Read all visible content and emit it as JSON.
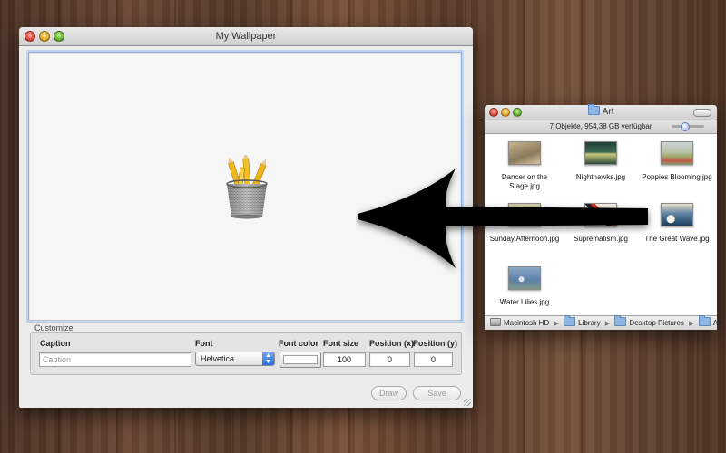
{
  "main_window": {
    "title": "My Wallpaper",
    "customize_label": "Customize",
    "caption": {
      "label": "Caption",
      "placeholder": "Caption",
      "value": ""
    },
    "font": {
      "label": "Font",
      "value": "Helvetica"
    },
    "font_color": {
      "label": "Font color",
      "value": "#ffffff"
    },
    "font_size": {
      "label": "Font size",
      "value": "100"
    },
    "position_x": {
      "label": "Position (x)",
      "value": "0"
    },
    "position_y": {
      "label": "Position (y)",
      "value": "0"
    },
    "buttons": {
      "draw": "Draw",
      "save": "Save"
    }
  },
  "finder": {
    "title": "Art",
    "status": "7 Objekte, 954,38 GB verfügbar",
    "files": [
      {
        "name": "Dancer on the Stage.jpg"
      },
      {
        "name": "Nighthawks.jpg"
      },
      {
        "name": "Poppies Blooming.jpg"
      },
      {
        "name": "Sunday Afternoon.jpg"
      },
      {
        "name": "Suprematism.jpg"
      },
      {
        "name": "The Great Wave.jpg"
      },
      {
        "name": "Water Lilies.jpg"
      }
    ],
    "path": [
      "Macintosh HD",
      "Library",
      "Desktop Pictures",
      "Art"
    ]
  },
  "icons": {
    "canvas_placeholder": "pencil-cup-icon",
    "drag_arrow": "arrow-left-icon",
    "folder": "folder-icon",
    "disk": "hard-drive-icon"
  }
}
